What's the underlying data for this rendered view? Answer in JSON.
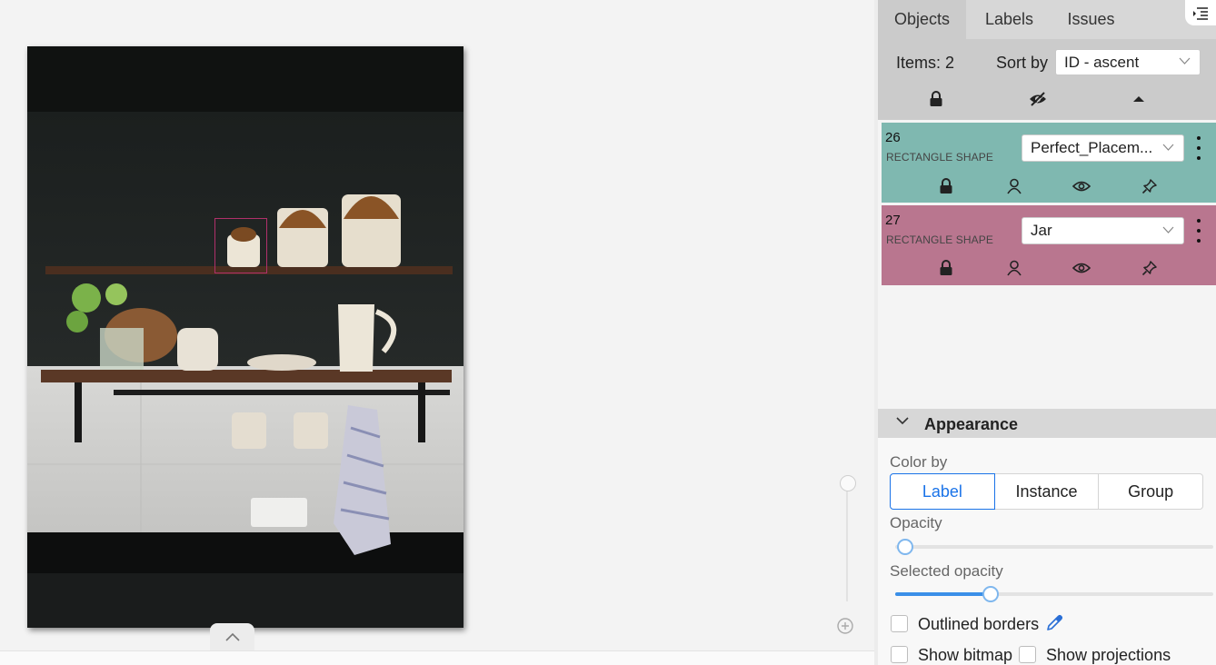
{
  "canvas": {
    "annotation_color": "#b0306a"
  },
  "panel": {
    "tabs": [
      {
        "label": "Objects",
        "active": true
      },
      {
        "label": "Labels",
        "active": false
      },
      {
        "label": "Issues",
        "active": false
      }
    ],
    "items_label": "Items: 2",
    "sort_label": "Sort by",
    "sort_value": "ID - ascent",
    "objects": [
      {
        "id": "26",
        "type": "RECTANGLE SHAPE",
        "label": "Perfect_Placem...",
        "color": "#7fb8b0"
      },
      {
        "id": "27",
        "type": "RECTANGLE SHAPE",
        "label": "Jar",
        "color": "#b9768f"
      }
    ],
    "appearance": {
      "title": "Appearance",
      "color_by_label": "Color by",
      "color_by_options": [
        "Label",
        "Instance",
        "Group"
      ],
      "color_by_selected": "Label",
      "opacity_label": "Opacity",
      "opacity_value": 0.03,
      "selected_opacity_label": "Selected opacity",
      "selected_opacity_value": 0.3,
      "outlined_borders_label": "Outlined borders",
      "outlined_borders_checked": false,
      "show_bitmap_label": "Show bitmap",
      "show_bitmap_checked": false,
      "show_projections_label": "Show projections",
      "show_projections_checked": false
    }
  }
}
